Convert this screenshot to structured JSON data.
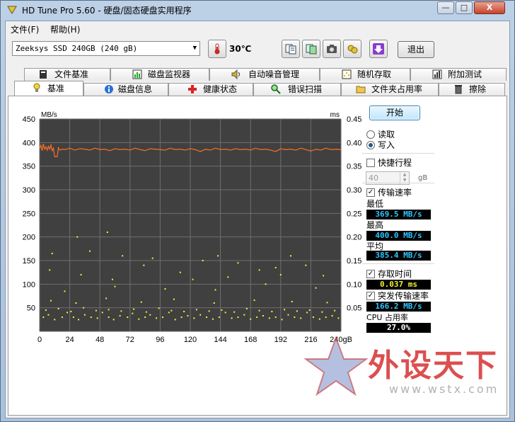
{
  "window": {
    "title": "HD Tune Pro 5.60 - 硬盘/固态硬盘实用程序",
    "minimize": "—",
    "maximize": "□",
    "close": "X"
  },
  "menu": [
    {
      "label": "文件(F)"
    },
    {
      "label": "帮助(H)"
    }
  ],
  "toolbar": {
    "drive": "Zeeksys SSD 240GB (240 gB)",
    "temperature": "30℃",
    "exit_label": "退出",
    "icons": [
      "thermometer-icon",
      "copy-text-icon",
      "copy-screen-icon",
      "camera-icon",
      "save-icon",
      "download-icon"
    ]
  },
  "tabs_row1": [
    {
      "label": "文件基准",
      "icon": "file-benchmark-icon"
    },
    {
      "label": "磁盘监视器",
      "icon": "disk-monitor-icon"
    },
    {
      "label": "自动噪音管理",
      "icon": "speaker-icon"
    },
    {
      "label": "随机存取",
      "icon": "random-access-icon"
    },
    {
      "label": "附加测试",
      "icon": "extra-tests-icon"
    }
  ],
  "tabs_row2": [
    {
      "label": "基准",
      "icon": "lightbulb-icon",
      "active": true
    },
    {
      "label": "磁盘信息",
      "icon": "info-icon"
    },
    {
      "label": "健康状态",
      "icon": "health-cross-icon"
    },
    {
      "label": "错误扫描",
      "icon": "magnifier-icon"
    },
    {
      "label": "文件夹占用率",
      "icon": "folder-icon"
    },
    {
      "label": "擦除",
      "icon": "trash-icon"
    }
  ],
  "controls": {
    "start_label": "开始",
    "read_label": "读取",
    "write_label": "写入",
    "mode_selected": "写入",
    "short_stroke_label": "快捷行程",
    "short_stroke_checked": false,
    "short_stroke_value": "40",
    "short_stroke_unit": "gB",
    "transfer_rate_label": "传输速率",
    "transfer_rate_checked": true,
    "min_label": "最低",
    "min_value": "369.5 MB/s",
    "max_label": "最高",
    "max_value": "400.0 MB/s",
    "avg_label": "平均",
    "avg_value": "385.4 MB/s",
    "access_time_label": "存取时间",
    "access_time_checked": true,
    "access_time_value": "0.037 ms",
    "burst_label": "突发传输速率",
    "burst_checked": true,
    "burst_value": "166.2 MB/s",
    "cpu_label": "CPU 占用率",
    "cpu_value": "27.0%"
  },
  "chart_data": {
    "type": "line",
    "left_unit": "MB/s",
    "right_unit": "ms",
    "y_left_ticks": [
      450,
      400,
      350,
      300,
      250,
      200,
      150,
      100,
      50
    ],
    "y_left_lim": [
      0,
      450
    ],
    "y_right_ticks": [
      "0.45",
      "0.40",
      "0.35",
      "0.30",
      "0.25",
      "0.20",
      "0.15",
      "0.10",
      "0.05"
    ],
    "y_right_lim": [
      0,
      0.45
    ],
    "x_ticks": [
      "0",
      "24",
      "48",
      "72",
      "96",
      "120",
      "144",
      "168",
      "192",
      "216",
      "240gB"
    ],
    "x_lim": [
      0,
      240
    ],
    "grid": true,
    "colors": {
      "background": "#404040",
      "grid": "#6e6e6e",
      "transfer": "#f06a2a",
      "access": "#f4f03a"
    },
    "series": [
      {
        "name": "传输速率",
        "axis": "left",
        "x": [
          0,
          1,
          2,
          3,
          4,
          5,
          6,
          7,
          8,
          9,
          10,
          11,
          12,
          13,
          14,
          15,
          16,
          18,
          20,
          24,
          28,
          32,
          36,
          40,
          44,
          48,
          52,
          56,
          60,
          64,
          68,
          72,
          76,
          80,
          84,
          88,
          92,
          96,
          100,
          104,
          108,
          112,
          116,
          120,
          124,
          128,
          132,
          136,
          140,
          144,
          148,
          152,
          156,
          160,
          164,
          168,
          172,
          176,
          180,
          184,
          188,
          192,
          196,
          200,
          204,
          208,
          212,
          216,
          220,
          224,
          228,
          232,
          236,
          240
        ],
        "y": [
          388,
          394,
          383,
          397,
          386,
          391,
          384,
          392,
          386,
          395,
          383,
          388,
          370,
          370,
          370,
          389,
          384,
          386,
          385,
          388,
          384,
          387,
          386,
          384,
          388,
          385,
          386,
          383,
          387,
          385,
          386,
          384,
          388,
          385,
          383,
          387,
          386,
          385,
          384,
          388,
          385,
          386,
          384,
          387,
          385,
          381,
          386,
          384,
          388,
          385,
          386,
          384,
          387,
          385,
          386,
          384,
          388,
          385,
          386,
          384,
          381,
          387,
          385,
          386,
          384,
          388,
          385,
          382,
          386,
          384,
          388,
          385,
          386,
          385
        ]
      },
      {
        "name": "存取时间",
        "axis": "right",
        "type": "scatter",
        "x": [
          3,
          7,
          12,
          18,
          22,
          27,
          31,
          36,
          41,
          46,
          50,
          55,
          59,
          64,
          70,
          74,
          79,
          84,
          88,
          93,
          98,
          103,
          108,
          113,
          118,
          123,
          128,
          133,
          138,
          143,
          148,
          153,
          158,
          163,
          168,
          173,
          178,
          183,
          188,
          193,
          198,
          203,
          208,
          213,
          218,
          223,
          228,
          233,
          238,
          5,
          15,
          25,
          35,
          45,
          55,
          65,
          75,
          85,
          95,
          105,
          115,
          125,
          135,
          145,
          155,
          165,
          175,
          185,
          195,
          205,
          215,
          225,
          235,
          9,
          29,
          53,
          81,
          107,
          139,
          171,
          201,
          229,
          20,
          60,
          100,
          140,
          180,
          220,
          8,
          33,
          58,
          83,
          112,
          150,
          188,
          226,
          10,
          40,
          66,
          90,
          130,
          158,
          175,
          200,
          212,
          122,
          142,
          192,
          30,
          54
        ],
        "y": [
          0.03,
          0.035,
          0.025,
          0.03,
          0.04,
          0.03,
          0.025,
          0.035,
          0.03,
          0.028,
          0.04,
          0.03,
          0.025,
          0.033,
          0.03,
          0.038,
          0.026,
          0.03,
          0.035,
          0.028,
          0.03,
          0.04,
          0.025,
          0.03,
          0.033,
          0.028,
          0.035,
          0.03,
          0.026,
          0.03,
          0.04,
          0.028,
          0.03,
          0.035,
          0.026,
          0.03,
          0.033,
          0.028,
          0.03,
          0.025,
          0.035,
          0.03,
          0.028,
          0.04,
          0.03,
          0.026,
          0.03,
          0.033,
          0.028,
          0.045,
          0.048,
          0.042,
          0.05,
          0.044,
          0.046,
          0.043,
          0.047,
          0.041,
          0.049,
          0.044,
          0.042,
          0.046,
          0.043,
          0.045,
          0.041,
          0.048,
          0.044,
          0.042,
          0.046,
          0.043,
          0.045,
          0.041,
          0.044,
          0.065,
          0.06,
          0.07,
          0.062,
          0.068,
          0.06,
          0.066,
          0.063,
          0.061,
          0.085,
          0.095,
          0.09,
          0.088,
          0.1,
          0.092,
          0.13,
          0.12,
          0.11,
          0.14,
          0.125,
          0.115,
          0.135,
          0.118,
          0.165,
          0.17,
          0.16,
          0.155,
          0.15,
          0.145,
          0.13,
          0.16,
          0.14,
          0.11,
          0.16,
          0.12,
          0.2,
          0.21
        ]
      }
    ]
  },
  "watermark": {
    "text": "外设天下",
    "url": "www.wstx.com"
  }
}
